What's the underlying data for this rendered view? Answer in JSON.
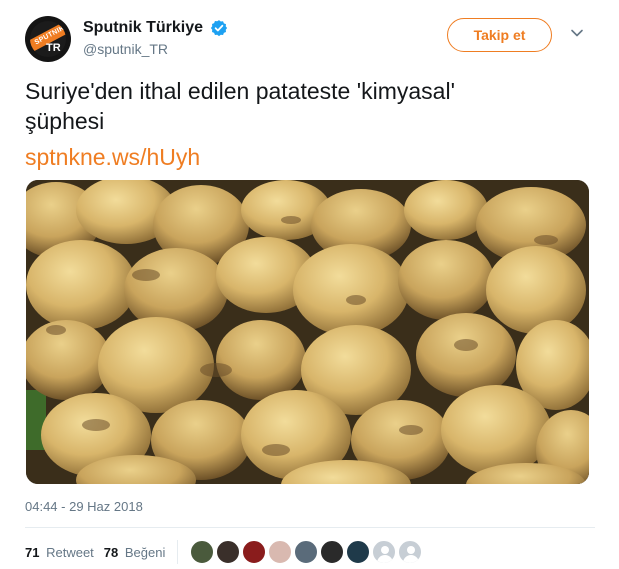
{
  "account": {
    "display_name": "Sputnik Türkiye",
    "handle": "@sputnik_TR",
    "avatar_band_text": "SPUTNIK",
    "avatar_tr_text": "TR",
    "verified": true
  },
  "follow_button": {
    "label": "Takip et"
  },
  "tweet": {
    "text_line1": "Suriye'den ithal edilen patateste 'kimyasal'",
    "text_line2": "şüphesi",
    "link": "sptnkne.ws/hUyh",
    "timestamp": "04:44 - 29 Haz 2018"
  },
  "stats": {
    "retweet_count": "71",
    "retweet_label": "Retweet",
    "like_count": "78",
    "like_label": "Beğeni"
  },
  "likers": [
    {
      "color": "#4a5a3c"
    },
    {
      "color": "#3a2f2a"
    },
    {
      "color": "#8a1c1c"
    },
    {
      "color": "#d9b9b0"
    },
    {
      "color": "#5a6b7a"
    },
    {
      "color": "#2a2a2a"
    },
    {
      "color": "#1f3a4a"
    },
    {
      "color": "default"
    },
    {
      "color": "default"
    }
  ],
  "colors": {
    "accent": "#ef7d22",
    "text": "#14171a",
    "muted": "#657786",
    "verified": "#1da1f2"
  }
}
